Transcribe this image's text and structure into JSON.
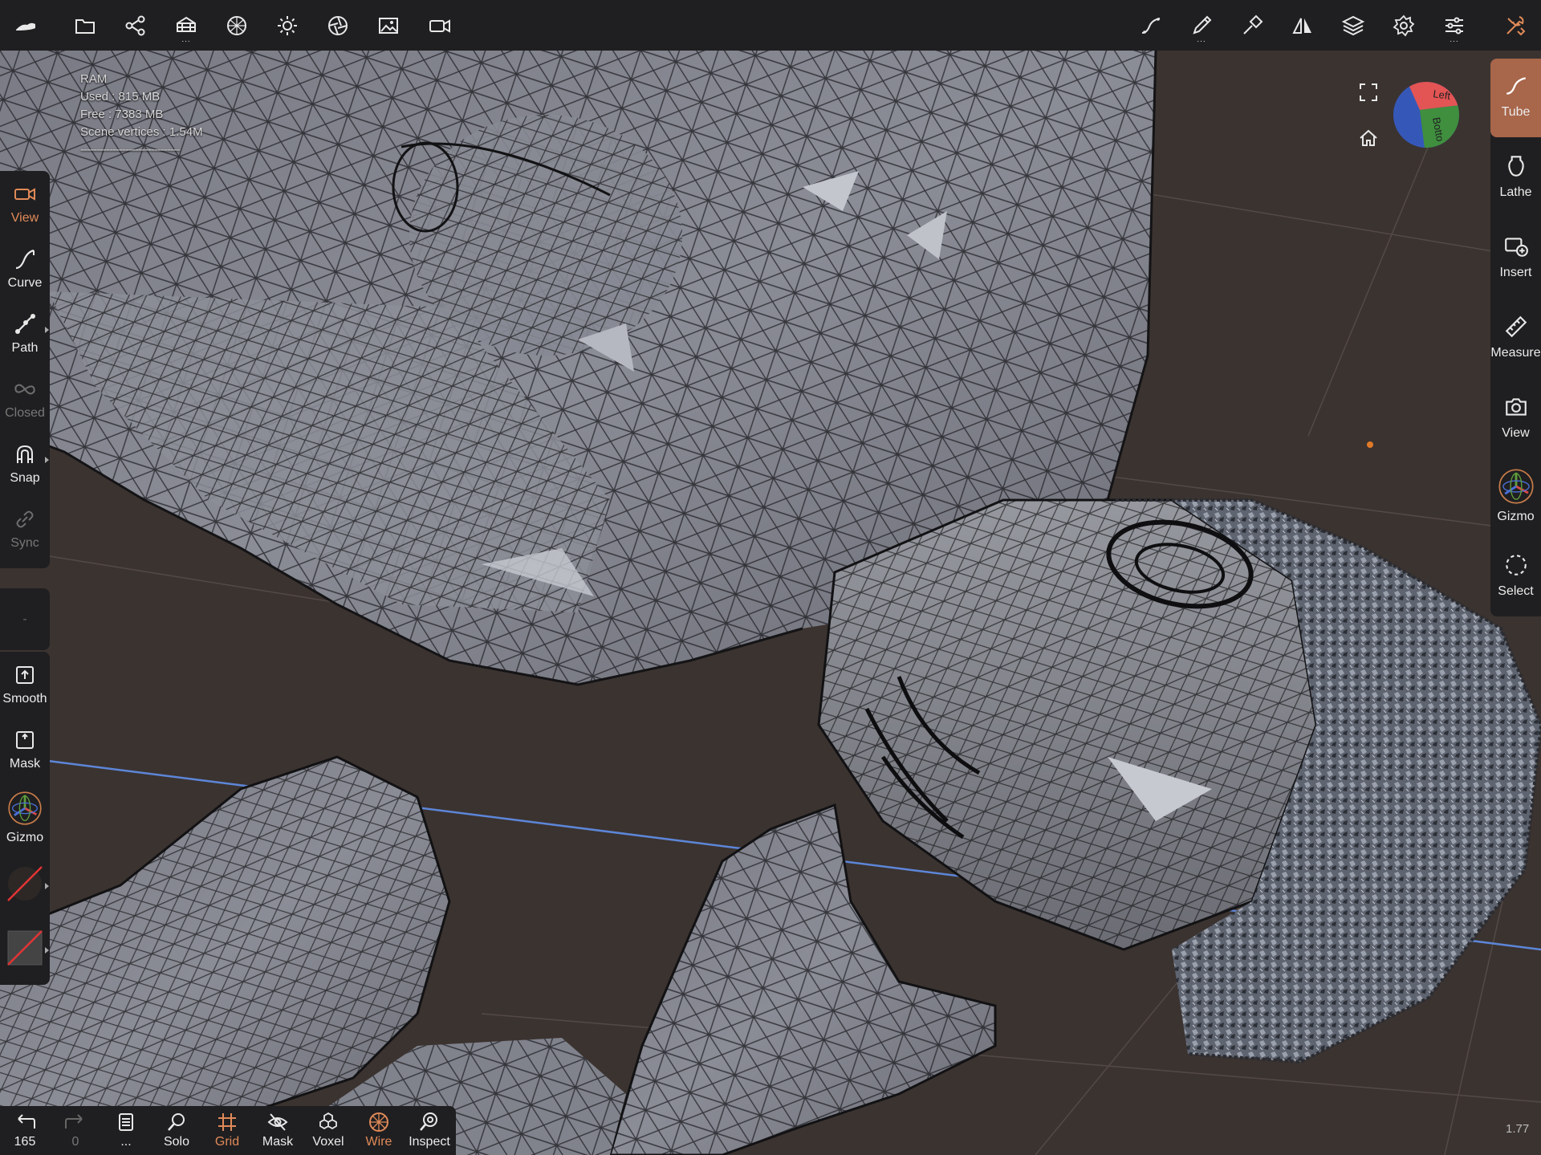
{
  "top_toolbar": {
    "left_icons": [
      "app-logo-icon",
      "folder-icon",
      "scene-tree-icon",
      "primitives-icon",
      "material-icon",
      "light-icon",
      "postprocess-icon",
      "background-image-icon",
      "camera-icon"
    ],
    "right_icons": [
      "stroke-icon",
      "brush-icon",
      "tool-hammer-icon",
      "symmetry-icon",
      "layers-icon",
      "settings-icon",
      "sliders-icon",
      "tools-icon"
    ],
    "dots": "..."
  },
  "stats": {
    "ram_label": "RAM",
    "used": "Used : 815 MB",
    "free": "Free : 7383 MB",
    "scene_vertices": "Scene vertices : 1.54M",
    "separator": "-------------------------------"
  },
  "left_toolbar": {
    "tools": [
      {
        "label": "View",
        "icon": "video-camera-icon",
        "active": true
      },
      {
        "label": "Curve",
        "icon": "curve-icon"
      },
      {
        "label": "Path",
        "icon": "path-icon"
      },
      {
        "label": "Closed",
        "icon": "infinity-icon",
        "disabled": true
      },
      {
        "label": "Snap",
        "icon": "magnet-icon"
      },
      {
        "label": "Sync",
        "icon": "link-icon",
        "disabled": true
      }
    ],
    "middle_placeholder": "-",
    "bottom_tools": [
      {
        "label": "Smooth",
        "icon": "smooth-icon"
      },
      {
        "label": "Mask",
        "icon": "mask-icon"
      },
      {
        "label": "Gizmo",
        "icon": "gizmo-icon"
      }
    ],
    "swatches": [
      "material-swatch",
      "color-swatch"
    ]
  },
  "right_toolbar": {
    "tools": [
      {
        "label": "Tube",
        "icon": "tube-icon",
        "active": true
      },
      {
        "label": "Lathe",
        "icon": "lathe-icon"
      },
      {
        "label": "Insert",
        "icon": "insert-icon"
      },
      {
        "label": "Measure",
        "icon": "ruler-icon"
      },
      {
        "label": "View",
        "icon": "camera-icon"
      },
      {
        "label": "Gizmo",
        "icon": "gizmo-icon"
      },
      {
        "label": "Select",
        "icon": "select-icon"
      }
    ]
  },
  "view_cube": {
    "face_left": "Left",
    "face_bottom": "Botto",
    "colors": {
      "left": "#e35454",
      "bottom": "#3f8f3e",
      "other": "#3558b8"
    }
  },
  "bottom_toolbar": {
    "tools": [
      {
        "label": "165",
        "icon": "undo-icon"
      },
      {
        "label": "0",
        "icon": "redo-icon",
        "disabled": true
      },
      {
        "label": "...",
        "icon": "history-icon"
      },
      {
        "label": "Solo",
        "icon": "search-icon"
      },
      {
        "label": "Grid",
        "icon": "grid-icon",
        "active": true
      },
      {
        "label": "Mask",
        "icon": "eye-slash-icon"
      },
      {
        "label": "Voxel",
        "icon": "voxel-icon"
      },
      {
        "label": "Wire",
        "icon": "wireframe-icon",
        "active": true
      },
      {
        "label": "Inspect",
        "icon": "inspect-icon"
      }
    ]
  },
  "fps": "1.77",
  "colors": {
    "accent": "#e08a58",
    "toolbar_bg": "#1f1f21",
    "viewport_bg": "#3b3330"
  }
}
